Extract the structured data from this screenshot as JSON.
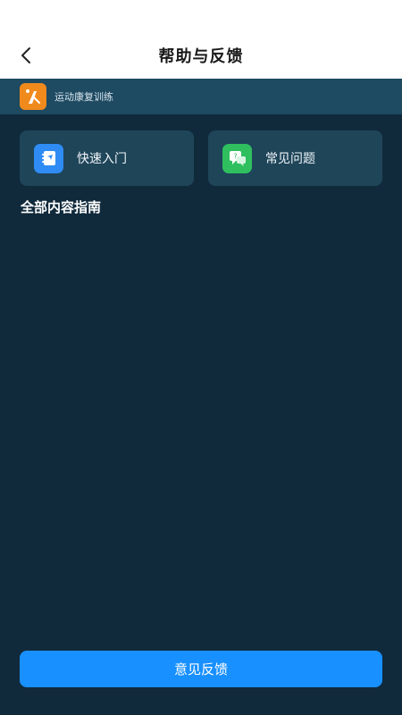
{
  "nav": {
    "title": "帮助与反馈",
    "back_icon": "chevron-left-icon"
  },
  "app_banner": {
    "name": "运动康复训练",
    "logo_icon": "app-logo-icon",
    "logo_color": "#f08a1c"
  },
  "cards": [
    {
      "label": "快速入门",
      "icon": "guide-book-icon",
      "icon_color": "#2f8cf5"
    },
    {
      "label": "常见问题",
      "icon": "faq-chat-icon",
      "icon_color": "#2fbf5f"
    }
  ],
  "section": {
    "title": "全部内容指南"
  },
  "footer": {
    "feedback_label": "意见反馈",
    "button_color": "#1890ff"
  },
  "colors": {
    "background": "#102a3c",
    "card": "#1f4559",
    "banner": "#1e4a62"
  }
}
